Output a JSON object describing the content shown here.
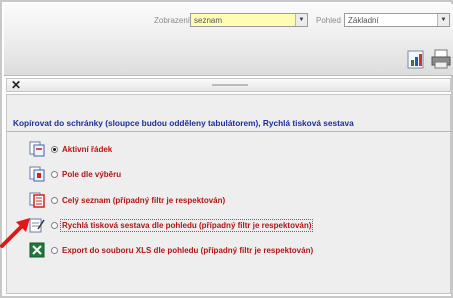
{
  "toolbar": {
    "view_label": "Zobrazení",
    "view_value": "seznam",
    "view2_label": "Pohled",
    "view2_value": "Základní"
  },
  "panel": {
    "title": "Kopírovat do schránky (sloupce budou odděleny tabulátorem), Rychlá tisková sestava",
    "options": [
      {
        "label": "Aktivní řádek",
        "icon": "copy-row-icon",
        "selected": true
      },
      {
        "label": "Pole dle výběru",
        "icon": "copy-selection-icon",
        "selected": false
      },
      {
        "label": "Celý seznam (případný filtr je respektován)",
        "icon": "copy-list-icon",
        "selected": false
      },
      {
        "label": "Rychlá tisková sestava dle pohledu (případný filtr je respektován)",
        "icon": "print-report-icon",
        "selected": false
      },
      {
        "label": "Export do souboru XLS dle pohledu (případný filtr je respektován)",
        "icon": "excel-export-icon",
        "selected": false
      }
    ]
  },
  "colors": {
    "title_blue": "#1d2f9a",
    "option_red": "#b21515",
    "pointer_red": "#e01818"
  }
}
